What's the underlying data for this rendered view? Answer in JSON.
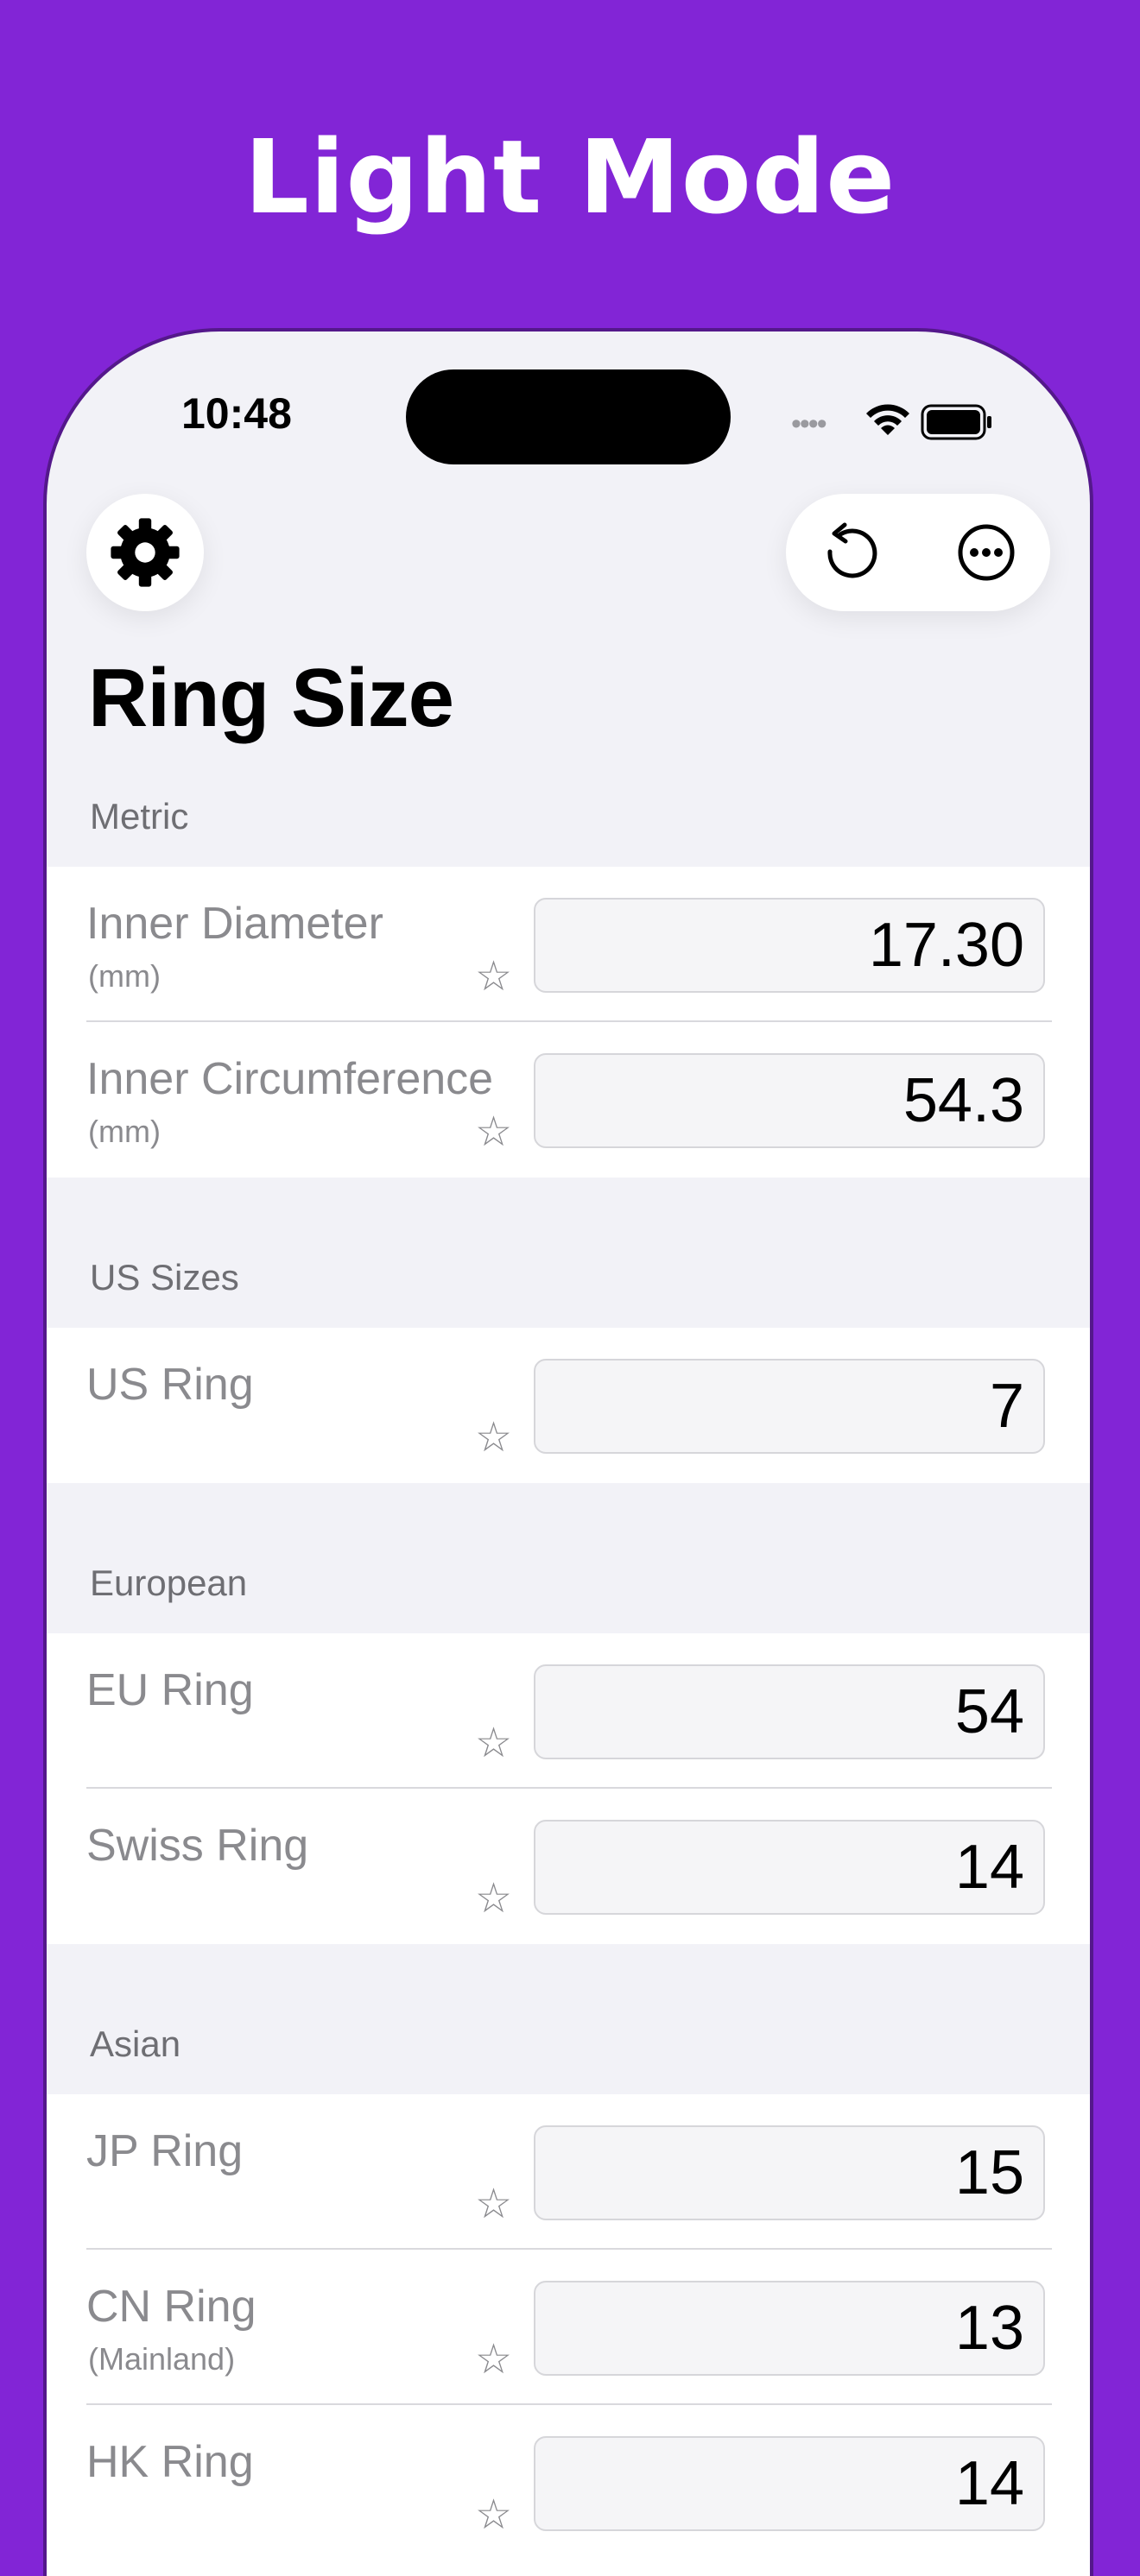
{
  "banner": {
    "title": "Light Mode"
  },
  "status_bar": {
    "time": "10:48",
    "signal_dots": "•••• "
  },
  "toolbar": {
    "settings_icon": "gear-icon",
    "reset_icon": "counterclockwise-arrow-icon",
    "more_icon": "ellipsis-circle-icon"
  },
  "page": {
    "title": "Ring Size"
  },
  "sections": [
    {
      "header": "Metric",
      "rows": [
        {
          "label": "Inner Diameter",
          "sub": "(mm)",
          "value": "17.30",
          "star": "☆"
        },
        {
          "label": "Inner Circumference",
          "sub": "(mm)",
          "value": "54.3",
          "star": "☆"
        }
      ]
    },
    {
      "header": "US Sizes",
      "rows": [
        {
          "label": "US Ring",
          "sub": "",
          "value": "7",
          "star": "☆"
        }
      ]
    },
    {
      "header": "European",
      "rows": [
        {
          "label": "EU Ring",
          "sub": "",
          "value": "54",
          "star": "☆"
        },
        {
          "label": "Swiss Ring",
          "sub": "",
          "value": "14",
          "star": "☆"
        }
      ]
    },
    {
      "header": "Asian",
      "rows": [
        {
          "label": "JP Ring",
          "sub": "",
          "value": "15",
          "star": "☆"
        },
        {
          "label": "CN Ring",
          "sub": "(Mainland)",
          "value": "13",
          "star": "☆"
        },
        {
          "label": "HK Ring",
          "sub": "",
          "value": "14",
          "star": "☆"
        }
      ]
    }
  ],
  "colors": {
    "banner_background": "#8225D6",
    "screen_background": "#F2F2F7",
    "label_text": "#8A8A8E"
  }
}
